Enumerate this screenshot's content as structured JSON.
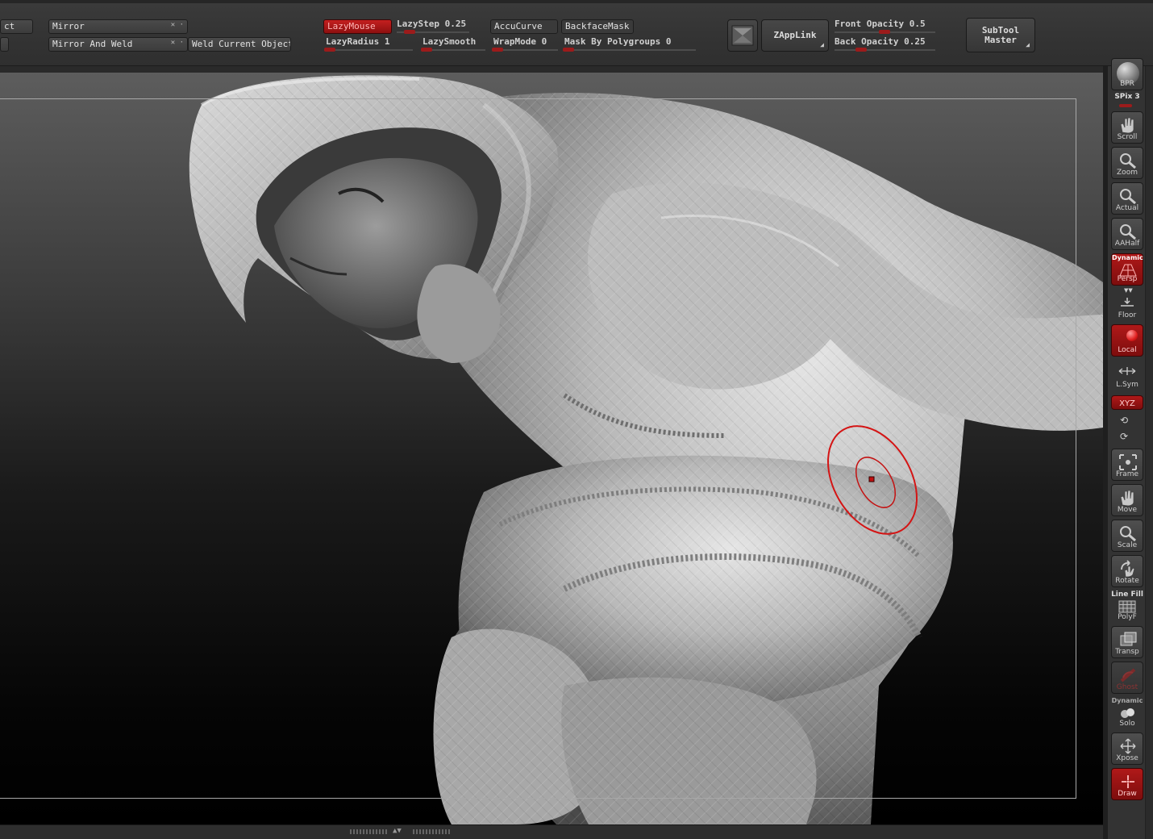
{
  "toolbar": {
    "object_cut": "ct",
    "mirror": "Mirror",
    "mirror_and_weld": "Mirror And Weld",
    "weld_current_object": "Weld Current Object",
    "lazy_mouse": "LazyMouse",
    "lazy_step_label": "LazyStep",
    "lazy_step_value": "0.25",
    "lazy_radius_label": "LazyRadius",
    "lazy_radius_value": "1",
    "lazy_smooth": "LazySmooth",
    "accu_curve": "AccuCurve",
    "wrap_mode_label": "WrapMode",
    "wrap_mode_value": "0",
    "backface_mask": "BackfaceMask",
    "mask_by_polygroups_label": "Mask By Polygroups",
    "mask_by_polygroups_value": "0",
    "zapplink": "ZAppLink",
    "front_opacity_label": "Front Opacity",
    "front_opacity_value": "0.5",
    "back_opacity_label": "Back Opacity",
    "back_opacity_value": "0.25",
    "subtool_master_line1": "SubTool",
    "subtool_master_line2": "Master"
  },
  "shelf": {
    "bpr": "BPR",
    "spix_label": "SPix",
    "spix_value": "3",
    "scroll": "Scroll",
    "zoom": "Zoom",
    "actual": "Actual",
    "aahalf": "AAHalf",
    "dynamic": "Dynamic",
    "persp": "Persp",
    "floor": "Floor",
    "local": "Local",
    "lsym": "L.Sym",
    "xyz": "XYZ",
    "frame": "Frame",
    "move": "Move",
    "scale": "Scale",
    "rotate": "Rotate",
    "line_fill": "Line Fill",
    "polyf": "PolyF",
    "transp": "Transp",
    "ghost": "Ghost",
    "dynamic_solo": "Dynamic",
    "solo": "Solo",
    "xpose": "Xpose",
    "draw": "Draw"
  },
  "colors": {
    "accent_red": "#b01919",
    "background": "#2a2a2a"
  }
}
